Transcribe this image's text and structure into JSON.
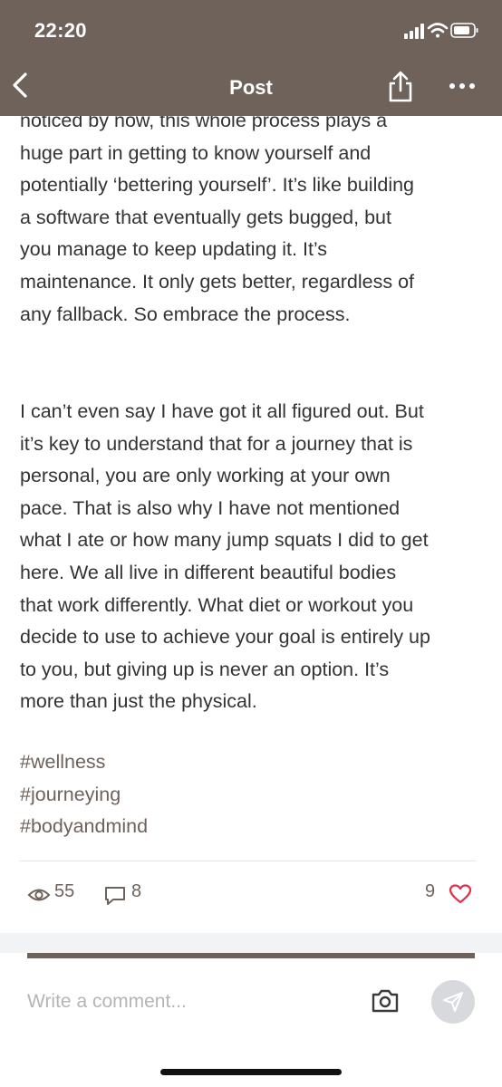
{
  "status_bar": {
    "time": "22:20"
  },
  "nav": {
    "title": "Post"
  },
  "post": {
    "paragraph_1": "noticed by now, this whole process plays a\nhuge part in getting to know yourself and\npotentially ‘bettering yourself’. It’s like building\na software that eventually gets bugged, but\nyou manage to keep updating it. It’s\nmaintenance. It only gets better, regardless of\nany fallback. So embrace the process.",
    "paragraph_2": "I can’t even say I have got it all figured out. But\nit’s key to understand that for a journey that is\npersonal, you are only working at your own\npace. That is also why I have not mentioned\nwhat I ate or how many jump squats I did to get\nhere. We all live in different beautiful bodies\nthat work differently. What diet or workout you\ndecide to use to achieve your goal is entirely up\nto you, but giving up is never an option. It’s\nmore than just the physical.",
    "hashtags": [
      "#wellness",
      "#journeying",
      "#bodyandmind"
    ]
  },
  "stats": {
    "views": "55",
    "comments": "8",
    "likes": "9"
  },
  "comment": {
    "placeholder": "Write a comment..."
  },
  "colors": {
    "brand": "#6e625b",
    "heart": "#e0314b",
    "send_bg": "#d7d9dc"
  },
  "icons": [
    "chevron-left-icon",
    "share-icon",
    "more-icon",
    "eye-icon",
    "comment-bubble-icon",
    "heart-icon",
    "camera-icon",
    "send-icon"
  ]
}
